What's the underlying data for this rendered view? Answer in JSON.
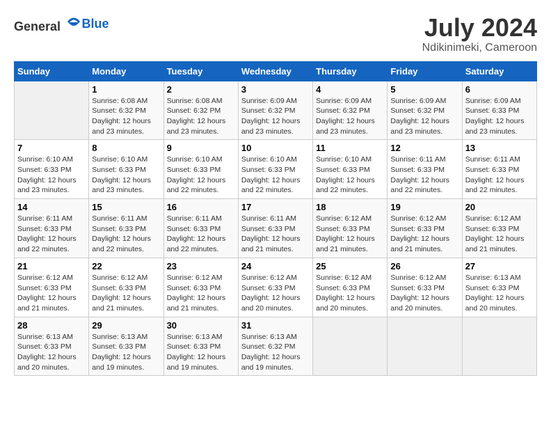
{
  "header": {
    "logo_general": "General",
    "logo_blue": "Blue",
    "title": "July 2024",
    "subtitle": "Ndikinimeki, Cameroon"
  },
  "calendar": {
    "days_of_week": [
      "Sunday",
      "Monday",
      "Tuesday",
      "Wednesday",
      "Thursday",
      "Friday",
      "Saturday"
    ],
    "weeks": [
      [
        {
          "day": "",
          "info": ""
        },
        {
          "day": "1",
          "info": "Sunrise: 6:08 AM\nSunset: 6:32 PM\nDaylight: 12 hours\nand 23 minutes."
        },
        {
          "day": "2",
          "info": "Sunrise: 6:08 AM\nSunset: 6:32 PM\nDaylight: 12 hours\nand 23 minutes."
        },
        {
          "day": "3",
          "info": "Sunrise: 6:09 AM\nSunset: 6:32 PM\nDaylight: 12 hours\nand 23 minutes."
        },
        {
          "day": "4",
          "info": "Sunrise: 6:09 AM\nSunset: 6:32 PM\nDaylight: 12 hours\nand 23 minutes."
        },
        {
          "day": "5",
          "info": "Sunrise: 6:09 AM\nSunset: 6:32 PM\nDaylight: 12 hours\nand 23 minutes."
        },
        {
          "day": "6",
          "info": "Sunrise: 6:09 AM\nSunset: 6:33 PM\nDaylight: 12 hours\nand 23 minutes."
        }
      ],
      [
        {
          "day": "7",
          "info": "Sunrise: 6:10 AM\nSunset: 6:33 PM\nDaylight: 12 hours\nand 23 minutes."
        },
        {
          "day": "8",
          "info": "Sunrise: 6:10 AM\nSunset: 6:33 PM\nDaylight: 12 hours\nand 23 minutes."
        },
        {
          "day": "9",
          "info": "Sunrise: 6:10 AM\nSunset: 6:33 PM\nDaylight: 12 hours\nand 22 minutes."
        },
        {
          "day": "10",
          "info": "Sunrise: 6:10 AM\nSunset: 6:33 PM\nDaylight: 12 hours\nand 22 minutes."
        },
        {
          "day": "11",
          "info": "Sunrise: 6:10 AM\nSunset: 6:33 PM\nDaylight: 12 hours\nand 22 minutes."
        },
        {
          "day": "12",
          "info": "Sunrise: 6:11 AM\nSunset: 6:33 PM\nDaylight: 12 hours\nand 22 minutes."
        },
        {
          "day": "13",
          "info": "Sunrise: 6:11 AM\nSunset: 6:33 PM\nDaylight: 12 hours\nand 22 minutes."
        }
      ],
      [
        {
          "day": "14",
          "info": "Sunrise: 6:11 AM\nSunset: 6:33 PM\nDaylight: 12 hours\nand 22 minutes."
        },
        {
          "day": "15",
          "info": "Sunrise: 6:11 AM\nSunset: 6:33 PM\nDaylight: 12 hours\nand 22 minutes."
        },
        {
          "day": "16",
          "info": "Sunrise: 6:11 AM\nSunset: 6:33 PM\nDaylight: 12 hours\nand 22 minutes."
        },
        {
          "day": "17",
          "info": "Sunrise: 6:11 AM\nSunset: 6:33 PM\nDaylight: 12 hours\nand 21 minutes."
        },
        {
          "day": "18",
          "info": "Sunrise: 6:12 AM\nSunset: 6:33 PM\nDaylight: 12 hours\nand 21 minutes."
        },
        {
          "day": "19",
          "info": "Sunrise: 6:12 AM\nSunset: 6:33 PM\nDaylight: 12 hours\nand 21 minutes."
        },
        {
          "day": "20",
          "info": "Sunrise: 6:12 AM\nSunset: 6:33 PM\nDaylight: 12 hours\nand 21 minutes."
        }
      ],
      [
        {
          "day": "21",
          "info": "Sunrise: 6:12 AM\nSunset: 6:33 PM\nDaylight: 12 hours\nand 21 minutes."
        },
        {
          "day": "22",
          "info": "Sunrise: 6:12 AM\nSunset: 6:33 PM\nDaylight: 12 hours\nand 21 minutes."
        },
        {
          "day": "23",
          "info": "Sunrise: 6:12 AM\nSunset: 6:33 PM\nDaylight: 12 hours\nand 21 minutes."
        },
        {
          "day": "24",
          "info": "Sunrise: 6:12 AM\nSunset: 6:33 PM\nDaylight: 12 hours\nand 20 minutes."
        },
        {
          "day": "25",
          "info": "Sunrise: 6:12 AM\nSunset: 6:33 PM\nDaylight: 12 hours\nand 20 minutes."
        },
        {
          "day": "26",
          "info": "Sunrise: 6:12 AM\nSunset: 6:33 PM\nDaylight: 12 hours\nand 20 minutes."
        },
        {
          "day": "27",
          "info": "Sunrise: 6:13 AM\nSunset: 6:33 PM\nDaylight: 12 hours\nand 20 minutes."
        }
      ],
      [
        {
          "day": "28",
          "info": "Sunrise: 6:13 AM\nSunset: 6:33 PM\nDaylight: 12 hours\nand 20 minutes."
        },
        {
          "day": "29",
          "info": "Sunrise: 6:13 AM\nSunset: 6:33 PM\nDaylight: 12 hours\nand 19 minutes."
        },
        {
          "day": "30",
          "info": "Sunrise: 6:13 AM\nSunset: 6:33 PM\nDaylight: 12 hours\nand 19 minutes."
        },
        {
          "day": "31",
          "info": "Sunrise: 6:13 AM\nSunset: 6:32 PM\nDaylight: 12 hours\nand 19 minutes."
        },
        {
          "day": "",
          "info": ""
        },
        {
          "day": "",
          "info": ""
        },
        {
          "day": "",
          "info": ""
        }
      ]
    ]
  }
}
